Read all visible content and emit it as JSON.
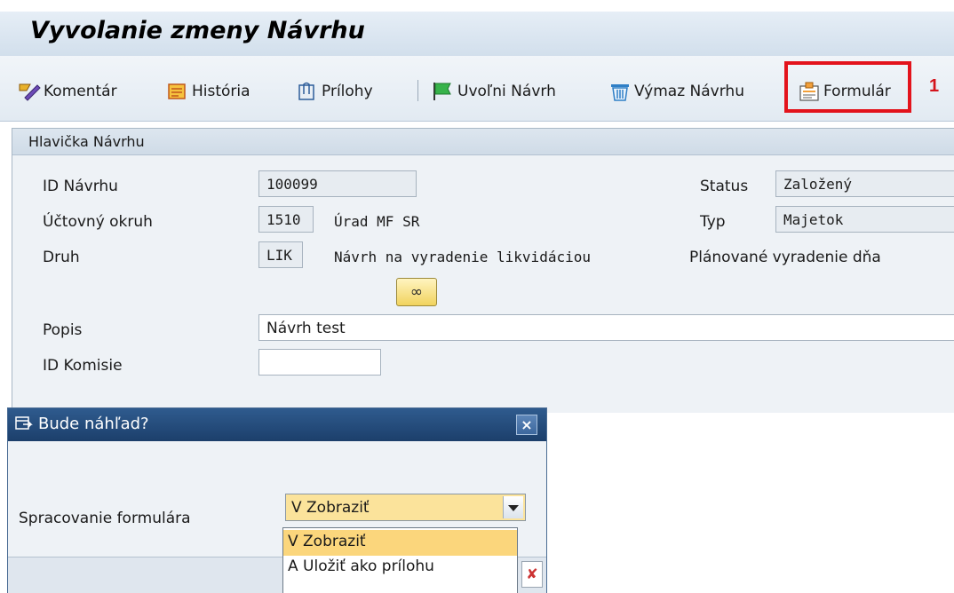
{
  "window": {
    "title": "Vyvolanie zmeny Návrhu"
  },
  "toolbar": {
    "comment": "Komentár",
    "history": "História",
    "attachments": "Prílohy",
    "release": "Uvoľni Návrh",
    "delete": "Výmaz Návrhu",
    "form": "Formulár",
    "annotation_number": "1"
  },
  "header_panel": {
    "title": "Hlavička Návrhu",
    "id_label": "ID Návrhu",
    "id_value": "100099",
    "status_label": "Status",
    "status_value": "Založený",
    "company_label": "Účtovný okruh",
    "company_code": "1510",
    "company_name": "Úrad MF SR",
    "type_label": "Typ",
    "type_value": "Majetok",
    "kind_label": "Druh",
    "kind_code": "LIK",
    "kind_text": "Návrh na vyradenie likvidáciou",
    "planned_label": "Plánované vyradenie dňa",
    "desc_label": "Popis",
    "desc_value": "Návrh test",
    "committee_label": "ID Komisie",
    "committee_value": ""
  },
  "dialog": {
    "title": "Bude náhľad?",
    "field_label": "Spracovanie formulára",
    "selected": "V Zobraziť",
    "options": [
      "V Zobraziť",
      "A Uložiť ako prílohu"
    ]
  },
  "colors": {
    "highlight": "#e3131c",
    "dialog_title_bg": "#2f5b8e",
    "selected_option": "#fbd67c"
  }
}
